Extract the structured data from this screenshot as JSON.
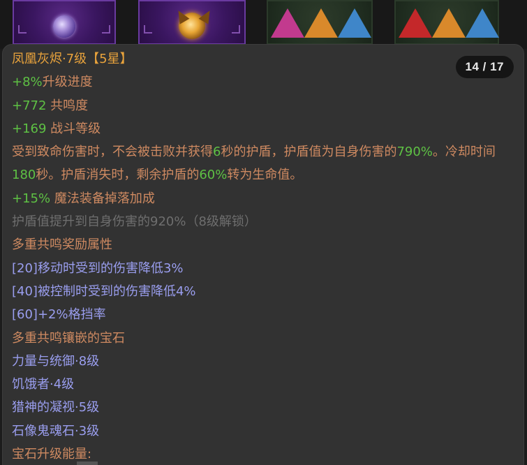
{
  "pager": "14 / 17",
  "title": "凤凰灰烬·7级【5星】",
  "stat_lines": [
    {
      "value": "+8%",
      "label": "升级进度"
    },
    {
      "value": "+772",
      "label": " 共鸣度"
    },
    {
      "value": "+169",
      "label": " 战斗等级"
    }
  ],
  "effect": {
    "p1": "受到致命伤害时，不会被击败并获得",
    "v1": "6",
    "p2": "秒的护盾，护盾值为自身伤害的",
    "v2": "790%",
    "p3": "。冷却时间",
    "v3": "180",
    "p4": "秒。护盾消失时，剩余护盾的",
    "v4": "60%",
    "p5": "转为生命值。"
  },
  "drop_bonus": {
    "value": "+15%",
    "label": " 魔法装备掉落加成"
  },
  "locked_upgrade": "护盾值提升到自身伤害的920%（8级解锁）",
  "resonance_header": "多重共鸣奖励属性",
  "resonance_bonuses": [
    "[20]移动时受到的伤害降低3%",
    "[40]被控制时受到的伤害降低4%",
    "[60]+2%格挡率"
  ],
  "socketed_header": "多重共鸣镶嵌的宝石",
  "socketed_gems": [
    "力量与统御·8级",
    "饥饿者·4级",
    "猎神的凝视·5级",
    "石像鬼魂石·3级"
  ],
  "gem_energy_label": "宝石升级能量:",
  "icons": {
    "slot1": "purple-swirl-orb-icon",
    "slot2": "phoenix-ember-orb-icon",
    "slot3": [
      "magenta-triangle-gem-icon",
      "amber-triangle-gem-icon",
      "blue-triangle-gem-icon"
    ],
    "slot4": [
      "red-triangle-gem-icon",
      "amber-triangle-gem-icon",
      "blue-triangle-gem-icon"
    ]
  },
  "colors": {
    "title": "#e9a33c",
    "value_green": "#5ec144",
    "text_brown": "#cf8a61",
    "locked_grey": "#6e6e6e",
    "bonus_blue": "#9a9eef",
    "panel_bg": "#323232"
  }
}
